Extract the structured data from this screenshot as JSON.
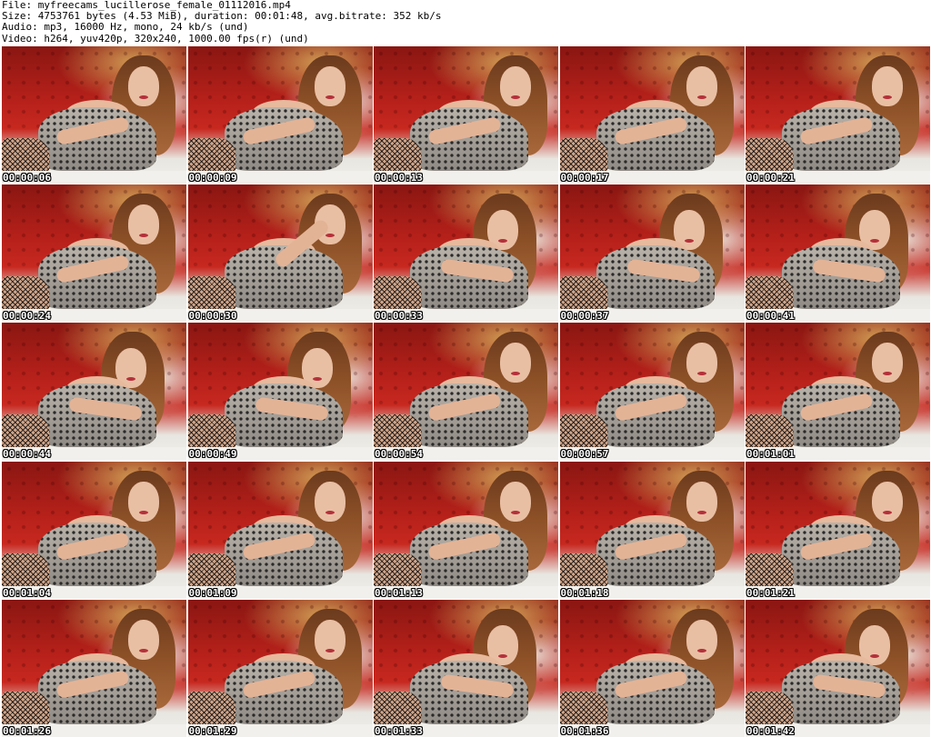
{
  "header": {
    "file_line": "File: myfreecams_lucillerose_female_01112016.mp4",
    "size_line": "Size: 4753761 bytes (4.53 MiB), duration: 00:01:48, avg.bitrate: 352 kb/s",
    "audio_line": "Audio: mp3, 16000 Hz, mono, 24 kb/s (und)",
    "video_line": "Video: h264, yuv420p, 320x240, 1000.00 fps(r) (und)"
  },
  "thumbnails": [
    {
      "timestamp": "00:00:06"
    },
    {
      "timestamp": "00:00:09"
    },
    {
      "timestamp": "00:00:13"
    },
    {
      "timestamp": "00:00:17"
    },
    {
      "timestamp": "00:00:21"
    },
    {
      "timestamp": "00:00:24"
    },
    {
      "timestamp": "00:00:30"
    },
    {
      "timestamp": "00:00:33"
    },
    {
      "timestamp": "00:00:37"
    },
    {
      "timestamp": "00:00:41"
    },
    {
      "timestamp": "00:00:44"
    },
    {
      "timestamp": "00:00:49"
    },
    {
      "timestamp": "00:00:54"
    },
    {
      "timestamp": "00:00:57"
    },
    {
      "timestamp": "00:01:01"
    },
    {
      "timestamp": "00:01:04"
    },
    {
      "timestamp": "00:01:09"
    },
    {
      "timestamp": "00:01:13"
    },
    {
      "timestamp": "00:01:18"
    },
    {
      "timestamp": "00:01:21"
    },
    {
      "timestamp": "00:01:26"
    },
    {
      "timestamp": "00:01:29"
    },
    {
      "timestamp": "00:01:33"
    },
    {
      "timestamp": "00:01:36"
    },
    {
      "timestamp": "00:01:42"
    }
  ]
}
